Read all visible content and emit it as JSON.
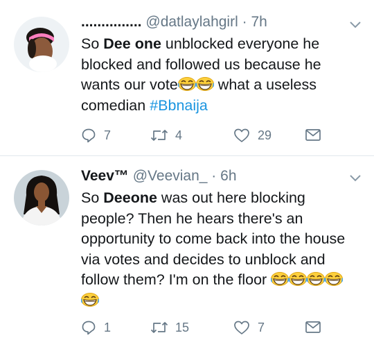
{
  "tweets": [
    {
      "display_name": "...............",
      "handle": "@datlaylahgirl",
      "time": "7h",
      "text": [
        "So ",
        "Dee one",
        " unblocked everyone he blocked and followed us because he wants our vote",
        " what a useless comedian ",
        "#Bbnaija"
      ],
      "replies": "7",
      "retweets": "4",
      "likes": "29"
    },
    {
      "display_name": "Veev™",
      "handle": "@Veevian_",
      "time": "6h",
      "text": [
        "So ",
        "Deeone",
        " was out here blocking people? Then he hears there's an opportunity to come back into the house via votes and decides to unblock and follow them? I'm on the floor "
      ],
      "replies": "1",
      "retweets": "15",
      "likes": "7"
    }
  ],
  "separator": " · ",
  "colors": {
    "text": "#14171a",
    "secondary": "#657786",
    "link": "#1b95e0",
    "divider": "#e1e8ed"
  },
  "icons": [
    "reply-icon",
    "retweet-icon",
    "like-icon",
    "message-icon",
    "chevron-down-icon",
    "laughing-emoji"
  ]
}
